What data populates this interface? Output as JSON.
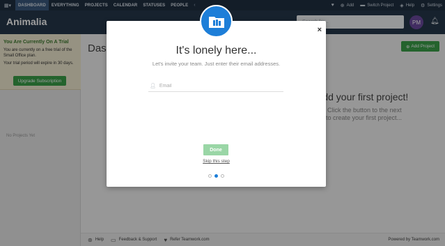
{
  "topnav": {
    "items": [
      {
        "label": "DASHBOARD",
        "active": true
      },
      {
        "label": "EVERYTHING",
        "active": false
      },
      {
        "label": "PROJECTS",
        "active": false
      },
      {
        "label": "CALENDAR",
        "active": false
      },
      {
        "label": "STATUSES",
        "active": false
      },
      {
        "label": "PEOPLE",
        "active": false
      }
    ],
    "right": {
      "add": "Add",
      "switch_project": "Switch Project",
      "help": "Help",
      "settings": "Settings"
    }
  },
  "header": {
    "brand": "Animalia",
    "search_placeholder": "Search for...",
    "avatar_initials": "PM"
  },
  "sidebar": {
    "trial_title": "You Are Currently On A Trial",
    "trial_text1": "You are currently on a free trial of the Small Office plan.",
    "trial_text2": "Your trial period will expire in 30 days.",
    "upgrade_label": "Upgrade Subscription",
    "no_projects": "No Projects Yet"
  },
  "main": {
    "page_title": "Dashboard",
    "add_project_label": "Add Project",
    "empty_title": "Add your first project!",
    "empty_line1": "Click the button to the next",
    "empty_line2": "to create your first project..."
  },
  "footer": {
    "help": "Help",
    "feedback": "Feedback & Support",
    "refer": "Refer Teamwork.com",
    "powered": "Powered by Teamwork.com"
  },
  "modal": {
    "title": "It's lonely here...",
    "subtitle": "Let's invite your team. Just enter their email addresses.",
    "email_placeholder": "Email",
    "done_label": "Done",
    "skip_label": "Skip this step",
    "close_label": "×",
    "step": {
      "current": 2,
      "total": 3
    }
  },
  "colors": {
    "accent": "#1d7ed8",
    "success": "#3aa14a",
    "nav_bg": "#1f2f42",
    "header_bg": "#26374b"
  }
}
